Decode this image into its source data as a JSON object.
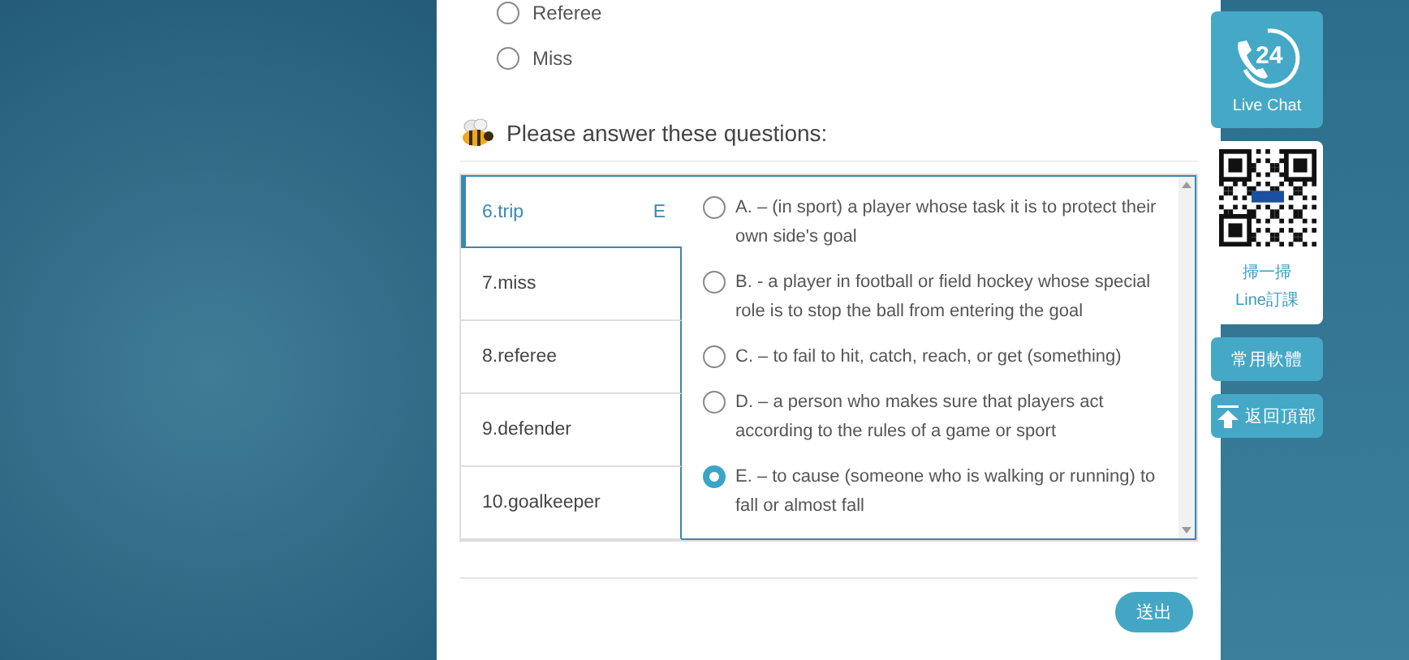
{
  "top_options": [
    {
      "label": "Referee",
      "selected": false
    },
    {
      "label": "Miss",
      "selected": false
    }
  ],
  "heading": "Please answer these questions:",
  "questions": [
    {
      "label": "6.trip",
      "answer": "E",
      "selected": true
    },
    {
      "label": "7.miss",
      "selected": false
    },
    {
      "label": "8.referee",
      "selected": false
    },
    {
      "label": "9.defender",
      "selected": false
    },
    {
      "label": "10.goalkeeper",
      "selected": false
    }
  ],
  "options": [
    {
      "text": "A. – (in sport) a player whose task it is to protect their own side's goal",
      "selected": false
    },
    {
      "text": "B. - a player in football or field hockey whose special role is to stop the ball from entering the goal",
      "selected": false
    },
    {
      "text": "C. – to fail to hit, catch, reach, or get (something)",
      "selected": false
    },
    {
      "text": "D. – a person who makes sure that players act according to the rules of a game or sport",
      "selected": false
    },
    {
      "text": "E. – to cause (someone who is walking or running) to fall or almost fall",
      "selected": true
    }
  ],
  "submit": "送出",
  "side": {
    "live_chat": {
      "badge": "24",
      "label": "Live Chat"
    },
    "qr_card": {
      "lines": [
        "掃一掃",
        "Line訂課"
      ]
    },
    "buttons": [
      {
        "label": "常用軟體",
        "kind": "text"
      },
      {
        "label": "返回頂部",
        "kind": "top"
      }
    ]
  }
}
